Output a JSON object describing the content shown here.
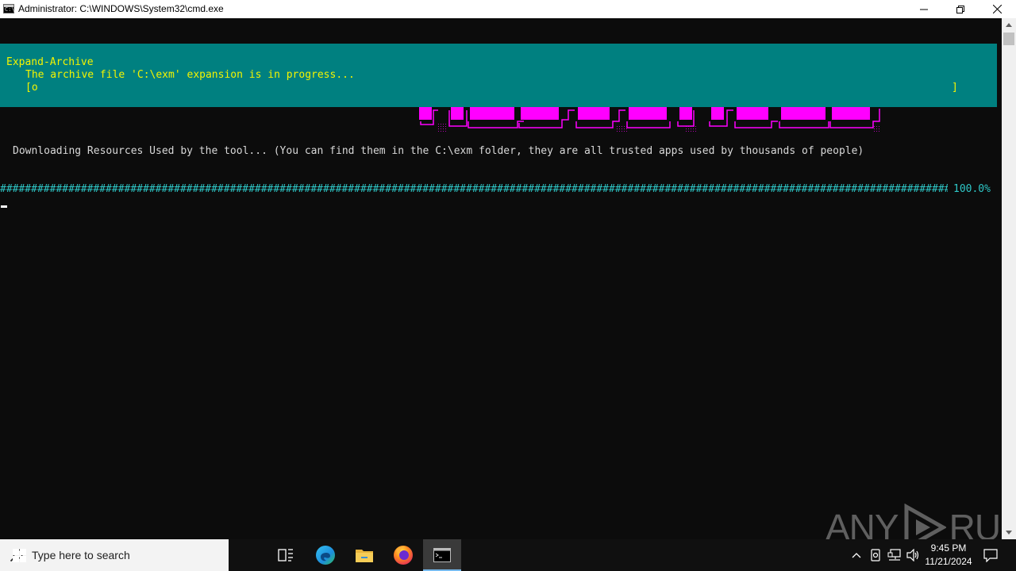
{
  "window": {
    "title": "Administrator: C:\\WINDOWS\\System32\\cmd.exe",
    "icon_text": "C:\\"
  },
  "console": {
    "progress": {
      "activity": "Expand-Archive",
      "status": "The archive file 'C:\\exm' expansion is in progress...",
      "bar_open": "[o",
      "bar_close": "]"
    },
    "downloading_text": "Downloading Resources Used by the tool... (You can find them in the C:\\exm folder, they are all trusted apps used by thousands of people)",
    "progress_bar_fill": "##################################################################################################################################################################",
    "progress_percent": "100.0%",
    "banner_color": "#ff00ff"
  },
  "watermark": {
    "left": "ANY",
    "right": "RUN"
  },
  "taskbar": {
    "search_placeholder": "Type here to search",
    "clock_time": "9:45 PM",
    "clock_date": "11/21/2024"
  },
  "colors": {
    "panel_bg": "#008080",
    "panel_text": "#f4f400",
    "bar": "#2ec7c7",
    "accent": "#76b9ed"
  }
}
